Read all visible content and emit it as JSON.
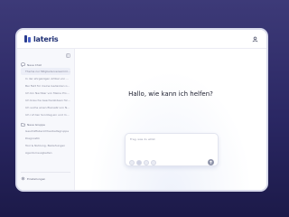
{
  "app": {
    "name": "lateris"
  },
  "sidebar": {
    "sections": [
      {
        "label": "Neue Chat",
        "items": [
          "Thema zur Mitgliederversammlung",
          "In der ehrgeizigen Artikel von Helmut",
          "Bei Fakt für meine Gedanken überall?",
          "Ich bin Nachbar von Meine Prozession",
          "Ich brauche Geschenkideen für Frank",
          "Ich suche einen Eiersatz von Nudeln",
          "Ich ruf den Sonntag ein und mach"
        ]
      },
      {
        "label": "Neue Gruppe",
        "items": [
          "Geschäftsberichtsarbeitsgruppe",
          "Diagnostik",
          "Tool & Nutzung, Beziehungen",
          "Agenturneuigkeiten"
        ]
      }
    ],
    "active_index": 0,
    "footer_label": "Einstellungen"
  },
  "main": {
    "greeting": "Hallo, wie kann ich helfen?",
    "composer": {
      "placeholder": "Frag, was du willst"
    }
  },
  "colors": {
    "accent": "#1e2f74",
    "background": "#2a2763"
  },
  "icons": {
    "logo": "lateris-logo-icon",
    "user": "user-icon",
    "collapse": "sidebar-collapse-icon",
    "new_chat": "chat-plus-icon",
    "group": "folder-icon",
    "settings": "gear-icon",
    "attach": "paperclip-icon",
    "send": "send-icon"
  }
}
